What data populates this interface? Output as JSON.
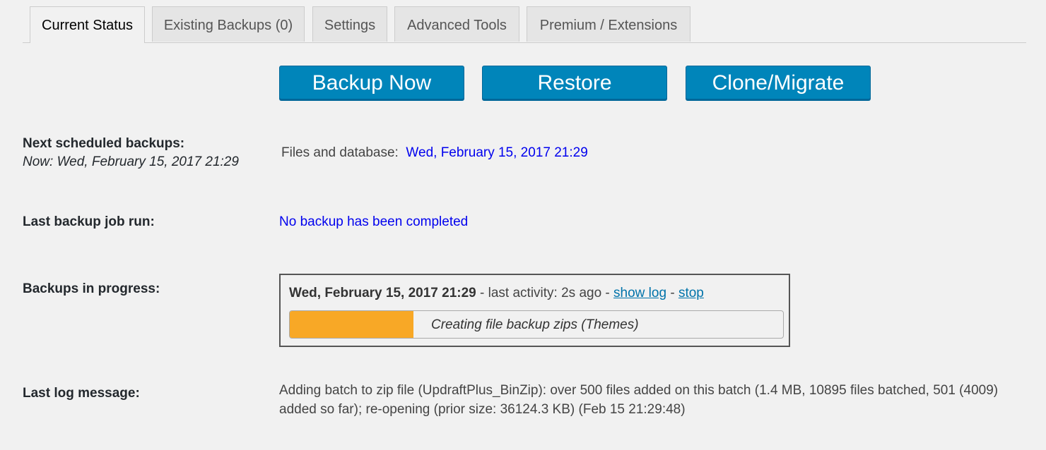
{
  "tabs": [
    {
      "label": "Current Status"
    },
    {
      "label": "Existing Backups (0)"
    },
    {
      "label": "Settings"
    },
    {
      "label": "Advanced Tools"
    },
    {
      "label": "Premium / Extensions"
    }
  ],
  "buttons": {
    "backup_now": "Backup Now",
    "restore": "Restore",
    "clone": "Clone/Migrate"
  },
  "next_scheduled": {
    "label": "Next scheduled backups:",
    "now": "Now: Wed, February 15, 2017 21:29",
    "files_label": "Files and database:",
    "files_value": "Wed, February 15, 2017 21:29"
  },
  "last_job": {
    "label": "Last backup job run:",
    "value": "No backup has been completed"
  },
  "in_progress": {
    "label": "Backups in progress:",
    "date": "Wed, February 15, 2017 21:29",
    "activity": " - last activity: 2s ago - ",
    "show_log": "show log",
    "sep": " - ",
    "stop": "stop",
    "status": "Creating file backup zips (Themes)",
    "progress_percent": 25,
    "progress_color": "#f8a826"
  },
  "last_log": {
    "label": "Last log message:",
    "message": "Adding batch to zip file (UpdraftPlus_BinZip): over 500 files added on this batch (1.4 MB, 10895 files batched, 501 (4009) added so far); re-opening (prior size: 36124.3 KB) (Feb 15 21:29:48)"
  }
}
